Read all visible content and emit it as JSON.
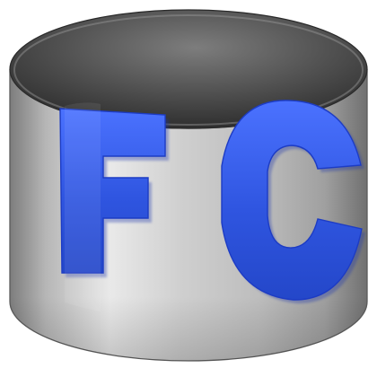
{
  "icon": {
    "name": "freecommander-logo",
    "lettering": "FC",
    "colors": {
      "cylinder_light": "#e7e7e7",
      "cylinder_mid": "#b7b7b7",
      "cylinder_dark": "#6f6f6f",
      "top_light": "#7a7a7a",
      "top_dark": "#303030",
      "letter_fill": "#2f55e0",
      "letter_shadow": "#1530a8",
      "background": "#ffffff"
    }
  }
}
